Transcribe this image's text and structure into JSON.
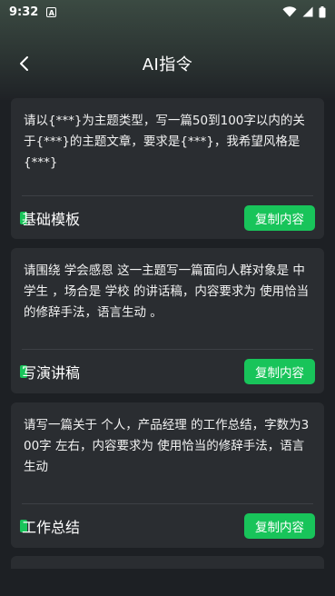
{
  "status_bar": {
    "time": "9:32",
    "notif_glyph": "A"
  },
  "header": {
    "title": "AI指令"
  },
  "cards": [
    {
      "text": "请以{***}为主题类型，写一篇50到100字以内的关于{***}的主题文章，要求是{***}，我希望风格是{***}",
      "label": "基础模板",
      "button": "复制内容"
    },
    {
      "text": "请围绕 学会感恩 这一主题写一篇面向人群对象是 中学生 ，场合是 学校 的讲话稿，内容要求为 使用恰当的修辞手法，语言生动 。",
      "label": "写演讲稿",
      "button": "复制内容"
    },
    {
      "text": "请写一篇关于 个人，产品经理 的工作总结，字数为300字 左右，内容要求为 使用恰当的修辞手法，语言生动",
      "label": "工作总结",
      "button": "复制内容"
    }
  ],
  "colors": {
    "accent": "#18c45a",
    "card": "#2a2d31",
    "background": "#1d2024"
  }
}
